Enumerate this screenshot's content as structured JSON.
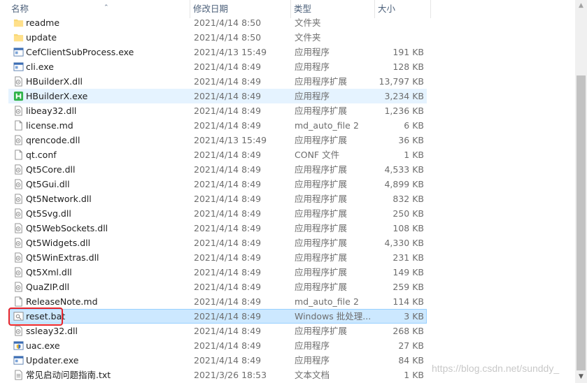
{
  "columns": {
    "name": "名称",
    "date": "修改日期",
    "type": "类型",
    "size": "大小"
  },
  "files": [
    {
      "name": "readme",
      "date": "2021/4/14 8:50",
      "type": "文件夹",
      "size": "",
      "icon": "folder-icon"
    },
    {
      "name": "update",
      "date": "2021/4/14 8:50",
      "type": "文件夹",
      "size": "",
      "icon": "folder-icon"
    },
    {
      "name": "CefClientSubProcess.exe",
      "date": "2021/4/13 15:49",
      "type": "应用程序",
      "size": "191 KB",
      "icon": "exe-icon"
    },
    {
      "name": "cli.exe",
      "date": "2021/4/14 8:49",
      "type": "应用程序",
      "size": "128 KB",
      "icon": "exe-icon"
    },
    {
      "name": "HBuilderX.dll",
      "date": "2021/4/14 8:49",
      "type": "应用程序扩展",
      "size": "13,797 KB",
      "icon": "dll-icon"
    },
    {
      "name": "HBuilderX.exe",
      "date": "2021/4/14 8:49",
      "type": "应用程序",
      "size": "3,234 KB",
      "icon": "hbuilder-icon",
      "state": "hover"
    },
    {
      "name": "libeay32.dll",
      "date": "2021/4/14 8:49",
      "type": "应用程序扩展",
      "size": "1,236 KB",
      "icon": "dll-icon"
    },
    {
      "name": "license.md",
      "date": "2021/4/14 8:49",
      "type": "md_auto_file",
      "type_suffix": "2",
      "size": "6 KB",
      "icon": "file-icon"
    },
    {
      "name": "qrencode.dll",
      "date": "2021/4/13 15:49",
      "type": "应用程序扩展",
      "size": "36 KB",
      "icon": "dll-icon"
    },
    {
      "name": "qt.conf",
      "date": "2021/4/14 8:49",
      "type": "CONF 文件",
      "size": "1 KB",
      "icon": "file-icon"
    },
    {
      "name": "Qt5Core.dll",
      "date": "2021/4/14 8:49",
      "type": "应用程序扩展",
      "size": "4,533 KB",
      "icon": "dll-icon"
    },
    {
      "name": "Qt5Gui.dll",
      "date": "2021/4/14 8:49",
      "type": "应用程序扩展",
      "size": "4,899 KB",
      "icon": "dll-icon"
    },
    {
      "name": "Qt5Network.dll",
      "date": "2021/4/14 8:49",
      "type": "应用程序扩展",
      "size": "832 KB",
      "icon": "dll-icon"
    },
    {
      "name": "Qt5Svg.dll",
      "date": "2021/4/14 8:49",
      "type": "应用程序扩展",
      "size": "250 KB",
      "icon": "dll-icon"
    },
    {
      "name": "Qt5WebSockets.dll",
      "date": "2021/4/14 8:49",
      "type": "应用程序扩展",
      "size": "108 KB",
      "icon": "dll-icon"
    },
    {
      "name": "Qt5Widgets.dll",
      "date": "2021/4/14 8:49",
      "type": "应用程序扩展",
      "size": "4,330 KB",
      "icon": "dll-icon"
    },
    {
      "name": "Qt5WinExtras.dll",
      "date": "2021/4/14 8:49",
      "type": "应用程序扩展",
      "size": "231 KB",
      "icon": "dll-icon"
    },
    {
      "name": "Qt5Xml.dll",
      "date": "2021/4/14 8:49",
      "type": "应用程序扩展",
      "size": "149 KB",
      "icon": "dll-icon"
    },
    {
      "name": "QuaZIP.dll",
      "date": "2021/4/14 8:49",
      "type": "应用程序扩展",
      "size": "259 KB",
      "icon": "dll-icon"
    },
    {
      "name": "ReleaseNote.md",
      "date": "2021/4/14 8:49",
      "type": "md_auto_file",
      "type_suffix": "2",
      "size": "114 KB",
      "icon": "file-icon"
    },
    {
      "name": "reset.bat",
      "date": "2021/4/14 8:49",
      "type": "Windows 批处理...",
      "size": "3 KB",
      "icon": "bat-icon",
      "state": "selected"
    },
    {
      "name": "ssleay32.dll",
      "date": "2021/4/14 8:49",
      "type": "应用程序扩展",
      "size": "268 KB",
      "icon": "dll-icon"
    },
    {
      "name": "uac.exe",
      "date": "2021/4/14 8:49",
      "type": "应用程序",
      "size": "27 KB",
      "icon": "uac-exe-icon"
    },
    {
      "name": "Updater.exe",
      "date": "2021/4/14 8:49",
      "type": "应用程序",
      "size": "84 KB",
      "icon": "exe-icon"
    },
    {
      "name": "常见启动问题指南.txt",
      "date": "2021/3/26 18:53",
      "type": "文本文档",
      "size": "1 KB",
      "icon": "txt-icon"
    }
  ],
  "watermark": "https://blog.csdn.net/sunddy_",
  "colors": {
    "selected_bg": "#cce8ff",
    "selected_border": "#99d1ff",
    "hover_bg": "#e5f3ff",
    "highlight_box": "#e8242a"
  }
}
